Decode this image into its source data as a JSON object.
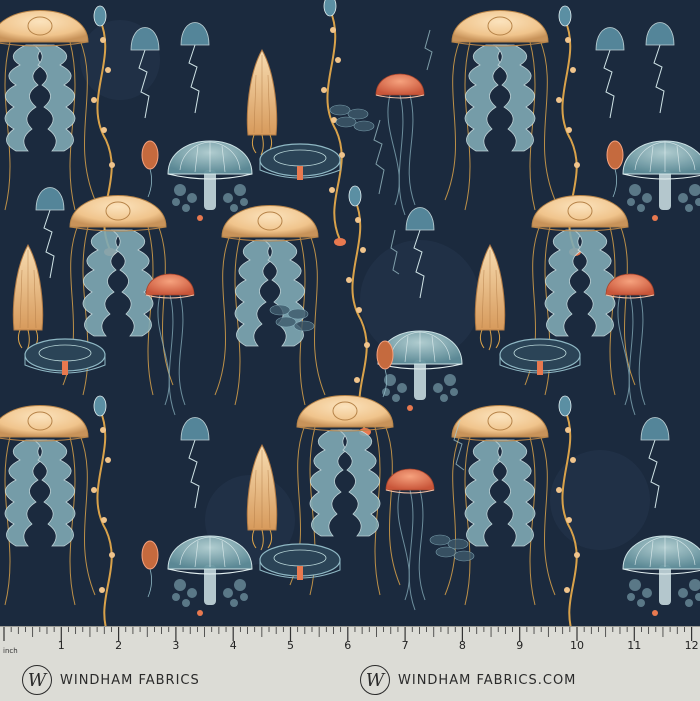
{
  "pattern": {
    "background": "#1b2a3e",
    "accent_colors": [
      "#f2c99a",
      "#e8794f",
      "#8fb8c4",
      "#d9a24a",
      "#5b8fa3"
    ],
    "motif": "jellyfish"
  },
  "ruler": {
    "unit_label": "inch",
    "numbers": [
      "1",
      "2",
      "3",
      "4",
      "5",
      "6",
      "7",
      "8",
      "9",
      "10",
      "11",
      "12"
    ]
  },
  "brand": {
    "logo_letter": "W",
    "left_text": "WINDHAM FABRICS",
    "right_text": "WINDHAM FABRICS.COM"
  }
}
